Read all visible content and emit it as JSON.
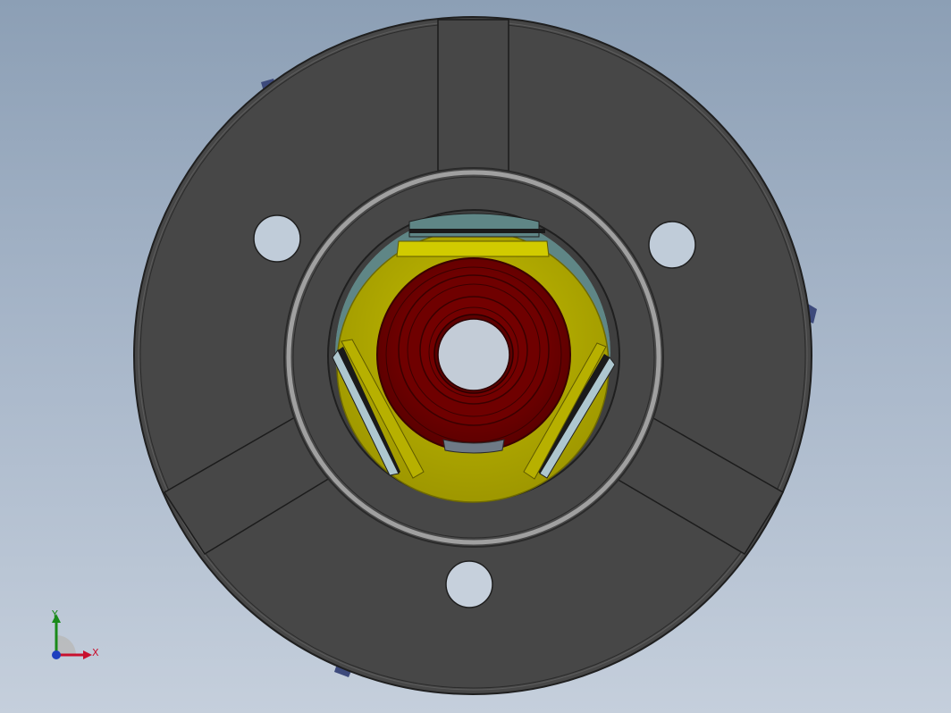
{
  "colors": {
    "background_top": "#8c9fb5",
    "background_bottom": "#c5cfdc",
    "chuck_body": "#474747",
    "chuck_edge": "#2a2a2a",
    "chuck_rim": "#9a9a9a",
    "jaw_yellow": "#b7b000",
    "jaw_yellow_dark": "#8d8700",
    "jaw_plate": "#d1cb00",
    "collet_red": "#7a0000",
    "collet_red_dark": "#4e0000",
    "bore_teal": "#5f8686",
    "insert_light": "#aec7cf",
    "axis_x": "#c8102e",
    "axis_y": "#1a8a1a",
    "axis_z": "#1f3fbf"
  },
  "triad": {
    "x_label": "X",
    "y_label": "Y"
  }
}
